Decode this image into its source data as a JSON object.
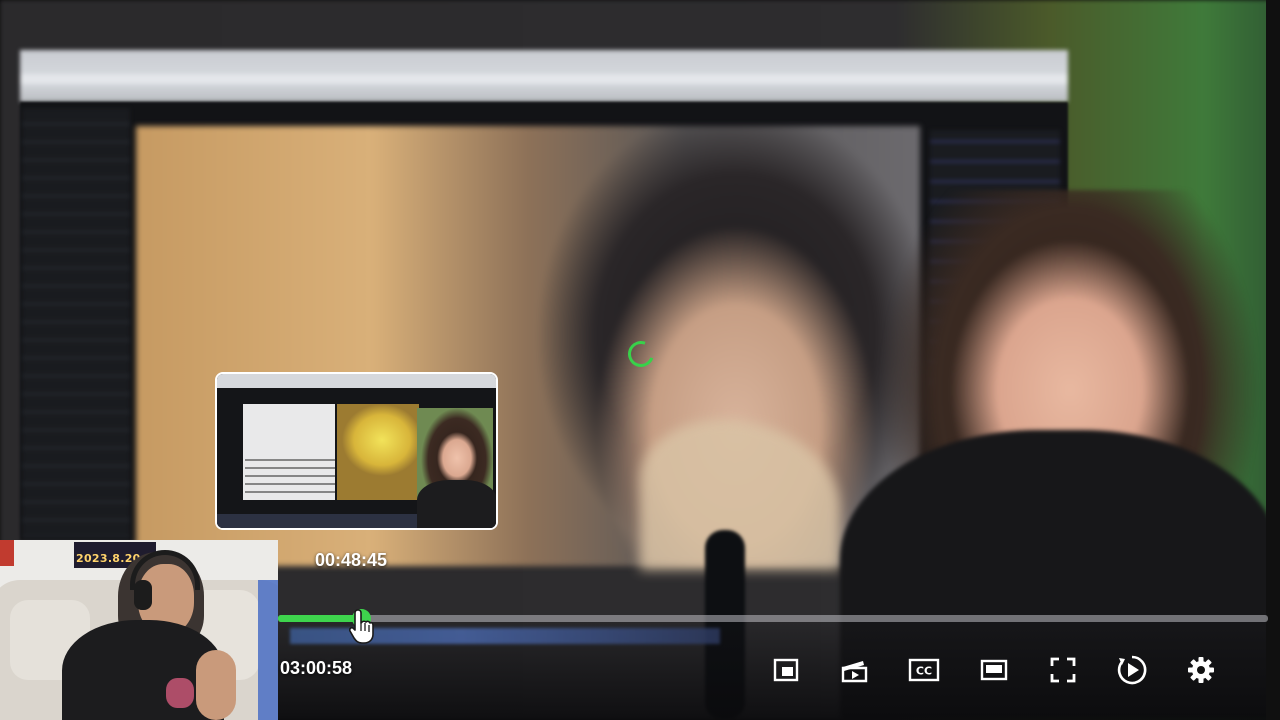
{
  "player": {
    "hover_time": "00:48:45",
    "total_time": "03:00:58",
    "progress_fraction": 0.084,
    "accent_color": "#3ed44d",
    "controls": [
      {
        "name": "miniplayer-icon"
      },
      {
        "name": "clip-icon"
      },
      {
        "name": "captions-icon"
      },
      {
        "name": "theater-mode-icon"
      },
      {
        "name": "fullscreen-icon"
      },
      {
        "name": "autoplay-icon"
      },
      {
        "name": "settings-icon"
      }
    ]
  },
  "webcam": {
    "date_text": "2023.8.20 SUN"
  }
}
